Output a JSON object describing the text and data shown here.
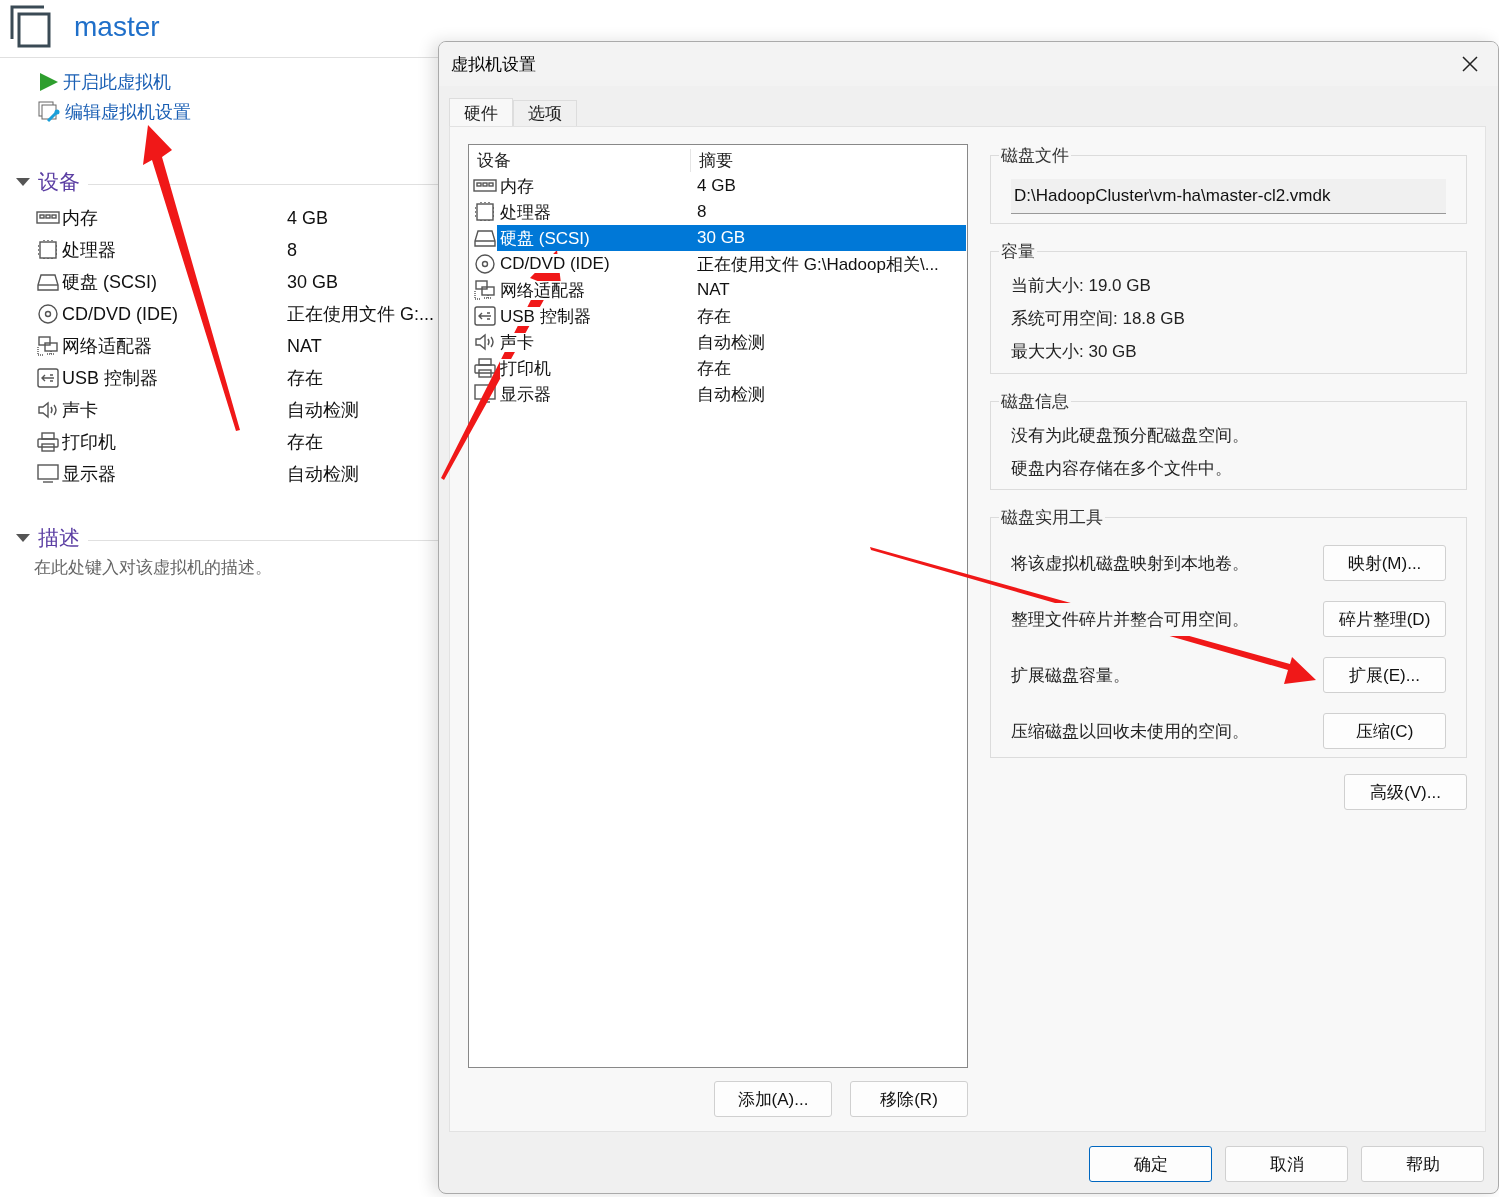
{
  "vm": {
    "name": "master"
  },
  "actions": [
    {
      "kind": "power",
      "label": "开启此虚拟机"
    },
    {
      "kind": "edit",
      "label": "编辑虚拟机设置"
    }
  ],
  "devices_section": {
    "title": "设备",
    "expanded": true,
    "devices": [
      {
        "kind": "memory",
        "name": "内存",
        "value": "4 GB"
      },
      {
        "kind": "cpu",
        "name": "处理器",
        "value": "8"
      },
      {
        "kind": "disk",
        "name": "硬盘 (SCSI)",
        "value": "30 GB"
      },
      {
        "kind": "cdrom",
        "name": "CD/DVD (IDE)",
        "value": "正在使用文件 G:..."
      },
      {
        "kind": "network",
        "name": "网络适配器",
        "value": "NAT"
      },
      {
        "kind": "usb",
        "name": "USB 控制器",
        "value": "存在"
      },
      {
        "kind": "sound",
        "name": "声卡",
        "value": "自动检测"
      },
      {
        "kind": "printer",
        "name": "打印机",
        "value": "存在"
      },
      {
        "kind": "display",
        "name": "显示器",
        "value": "自动检测"
      }
    ]
  },
  "description_section": {
    "title": "描述",
    "expanded": true,
    "placeholder": "在此处键入对该虚拟机的描述。"
  },
  "dialog": {
    "title": "虚拟机设置",
    "tabs": [
      {
        "label": "硬件",
        "selected": true
      },
      {
        "label": "选项",
        "selected": false
      }
    ],
    "device_list": {
      "columns": [
        "设备",
        "摘要"
      ],
      "rows": [
        {
          "kind": "memory",
          "device": "内存",
          "summary": "4 GB",
          "selected": false
        },
        {
          "kind": "cpu",
          "device": "处理器",
          "summary": "8",
          "selected": false
        },
        {
          "kind": "disk",
          "device": "硬盘 (SCSI)",
          "summary": "30 GB",
          "selected": true
        },
        {
          "kind": "cdrom",
          "device": "CD/DVD (IDE)",
          "summary": "正在使用文件 G:\\Hadoop相关\\...",
          "selected": false
        },
        {
          "kind": "network",
          "device": "网络适配器",
          "summary": "NAT",
          "selected": false
        },
        {
          "kind": "usb",
          "device": "USB 控制器",
          "summary": "存在",
          "selected": false
        },
        {
          "kind": "sound",
          "device": "声卡",
          "summary": "自动检测",
          "selected": false
        },
        {
          "kind": "printer",
          "device": "打印机",
          "summary": "存在",
          "selected": false
        },
        {
          "kind": "display",
          "device": "显示器",
          "summary": "自动检测",
          "selected": false
        }
      ]
    },
    "list_buttons": [
      "添加(A)...",
      "移除(R)"
    ],
    "disk_file": {
      "title": "磁盘文件",
      "path": "D:\\HadoopCluster\\vm-ha\\master-cl2.vmdk"
    },
    "capacity": {
      "title": "容量",
      "lines": [
        "当前大小: 19.0 GB",
        "系统可用空间: 18.8 GB",
        "最大大小: 30 GB"
      ]
    },
    "disk_info": {
      "title": "磁盘信息",
      "lines": [
        "没有为此硬盘预分配磁盘空间。",
        "硬盘内容存储在多个文件中。"
      ]
    },
    "utilities": {
      "title": "磁盘实用工具",
      "rows": [
        {
          "text": "将该虚拟机磁盘映射到本地卷。",
          "button": "映射(M)..."
        },
        {
          "text": "整理文件碎片并整合可用空间。",
          "button": "碎片整理(D)"
        },
        {
          "text": "扩展磁盘容量。",
          "button": "扩展(E)..."
        },
        {
          "text": "压缩磁盘以回收未使用的空间。",
          "button": "压缩(C)"
        }
      ]
    },
    "advanced_button": "高级(V)...",
    "footer_buttons": [
      {
        "label": "确定",
        "default": true
      },
      {
        "label": "取消",
        "default": false
      },
      {
        "label": "帮助",
        "default": false
      }
    ]
  }
}
